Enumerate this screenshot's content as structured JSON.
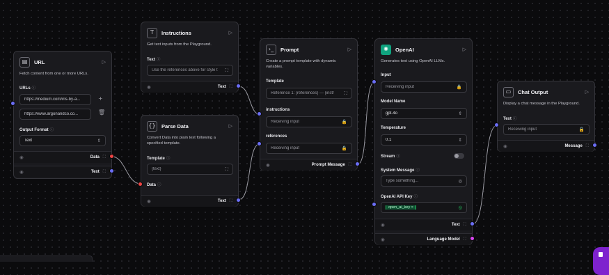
{
  "colors": {
    "background": "#0b0b0d",
    "node_bg": "#1a1a1e",
    "handle_text": "#6b6ef5",
    "handle_data": "#ef4444",
    "handle_model": "#d946ef",
    "api_key_chip": "#22c55e"
  },
  "url_node": {
    "title": "URL",
    "icon": "globe-grid-icon",
    "description": "Fetch content from one or more URLs.",
    "urls_label": "URLs",
    "url_1": "https://medium.com/iris-by-a...",
    "url_2": "https://www.argonandco.co...",
    "output_format_label": "Output Format",
    "output_format_value": "Text",
    "out_data": "Data",
    "out_text": "Text"
  },
  "instructions_node": {
    "title": "Instructions",
    "icon": "text-icon",
    "description": "Get text inputs from the Playground.",
    "text_label": "Text",
    "text_value": "Use the references above for style t",
    "out_text": "Text"
  },
  "parse_node": {
    "title": "Parse Data",
    "icon": "braces-icon",
    "description": "Convert Data into plain text following a specified template.",
    "template_label": "Template",
    "template_value": "{text}",
    "data_label": "Data",
    "out_text": "Text"
  },
  "prompt_node": {
    "title": "Prompt",
    "icon": "terminal-icon",
    "description": "Create a prompt template with dynamic variables.",
    "template_label": "Template",
    "template_value": "Reference 1: {references} --- {instr",
    "instructions_label": "instructions",
    "instructions_value": "Receiving input",
    "references_label": "references",
    "references_value": "Receiving input",
    "out_prompt": "Prompt Message"
  },
  "openai_node": {
    "title": "OpenAI",
    "icon": "openai-icon",
    "description": "Generates text using OpenAI LLMs.",
    "input_label": "Input",
    "input_value": "Receiving input",
    "model_label": "Model Name",
    "model_value": "gpt-4o",
    "temperature_label": "Temperature",
    "temperature_value": "0.1",
    "stream_label": "Stream",
    "system_label": "System Message",
    "system_placeholder": "Type something...",
    "apikey_label": "OpenAI API Key",
    "apikey_value": "open_ai_key",
    "out_text": "Text",
    "out_model": "Language Model"
  },
  "chat_node": {
    "title": "Chat Output",
    "icon": "chat-icon",
    "description": "Display a chat message in the Playground.",
    "text_label": "Text",
    "text_value": "Receiving input",
    "out_message": "Message"
  }
}
